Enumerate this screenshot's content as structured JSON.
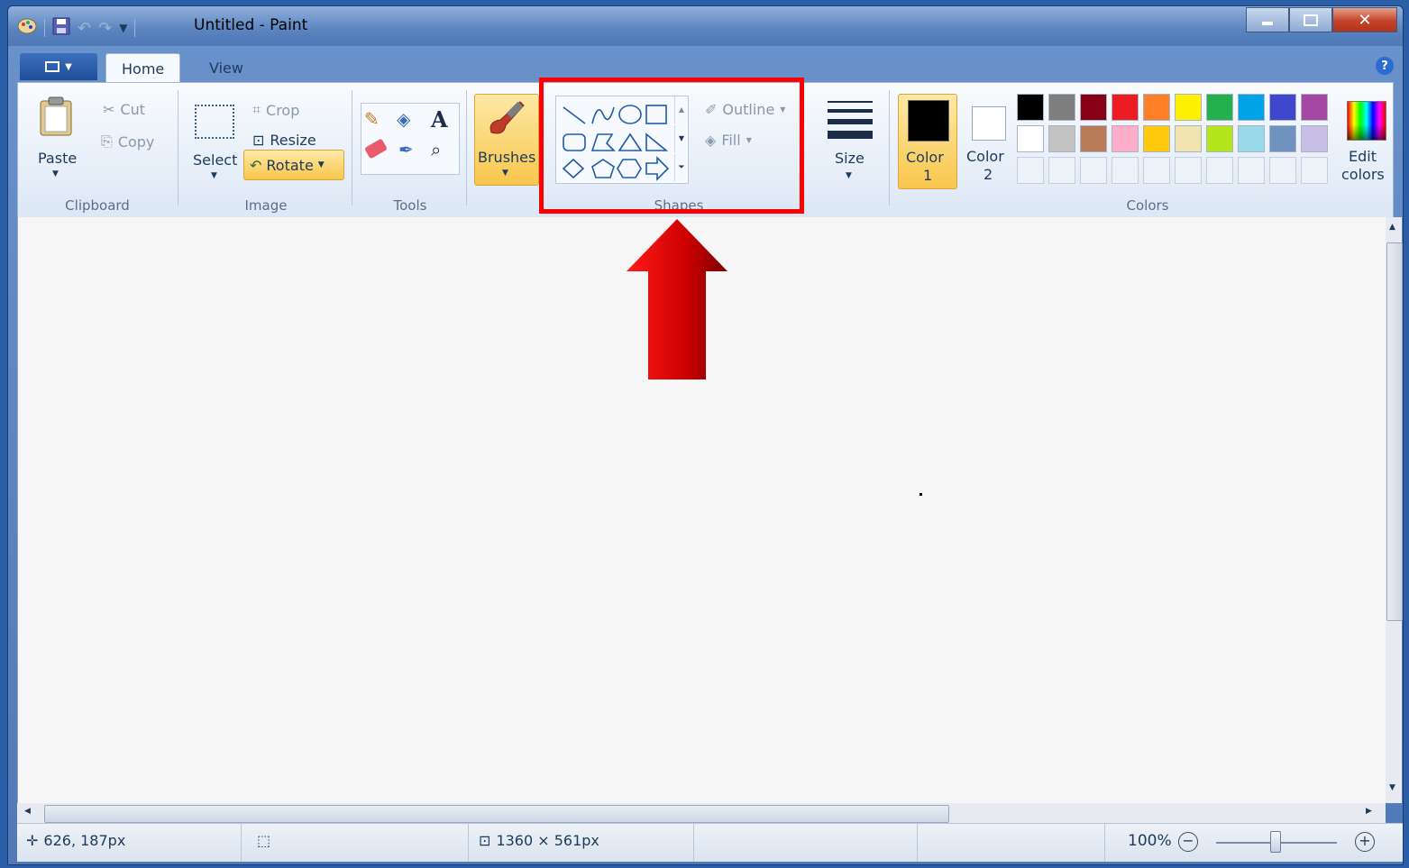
{
  "window": {
    "title": "Untitled - Paint"
  },
  "tabs": {
    "home": "Home",
    "view": "View"
  },
  "clipboard": {
    "paste": "Paste",
    "cut": "Cut",
    "copy": "Copy",
    "group": "Clipboard"
  },
  "image": {
    "select": "Select",
    "crop": "Crop",
    "resize": "Resize",
    "rotate": "Rotate",
    "group": "Image"
  },
  "tools": {
    "group": "Tools"
  },
  "brushes": {
    "label": "Brushes"
  },
  "shapes": {
    "outline": "Outline",
    "fill": "Fill",
    "group": "Shapes"
  },
  "size": {
    "label": "Size"
  },
  "colors": {
    "color1": "Color",
    "color1_num": "1",
    "color2": "Color",
    "color2_num": "2",
    "edit": "Edit",
    "edit2": "colors",
    "group": "Colors",
    "row1": [
      "#000000",
      "#7f7f7f",
      "#880015",
      "#ed1c24",
      "#ff7f27",
      "#fff200",
      "#22b14c",
      "#00a2e8",
      "#3f48cc",
      "#a349a4"
    ],
    "row2": [
      "#ffffff",
      "#c3c3c3",
      "#b97a57",
      "#ffaec9",
      "#ffc90e",
      "#efe4b0",
      "#b5e61d",
      "#99d9ea",
      "#7092be",
      "#c8bfe7"
    ]
  },
  "status": {
    "cursor": "626, 187px",
    "canvas_size": "1360 × 561px",
    "zoom": "100%"
  }
}
